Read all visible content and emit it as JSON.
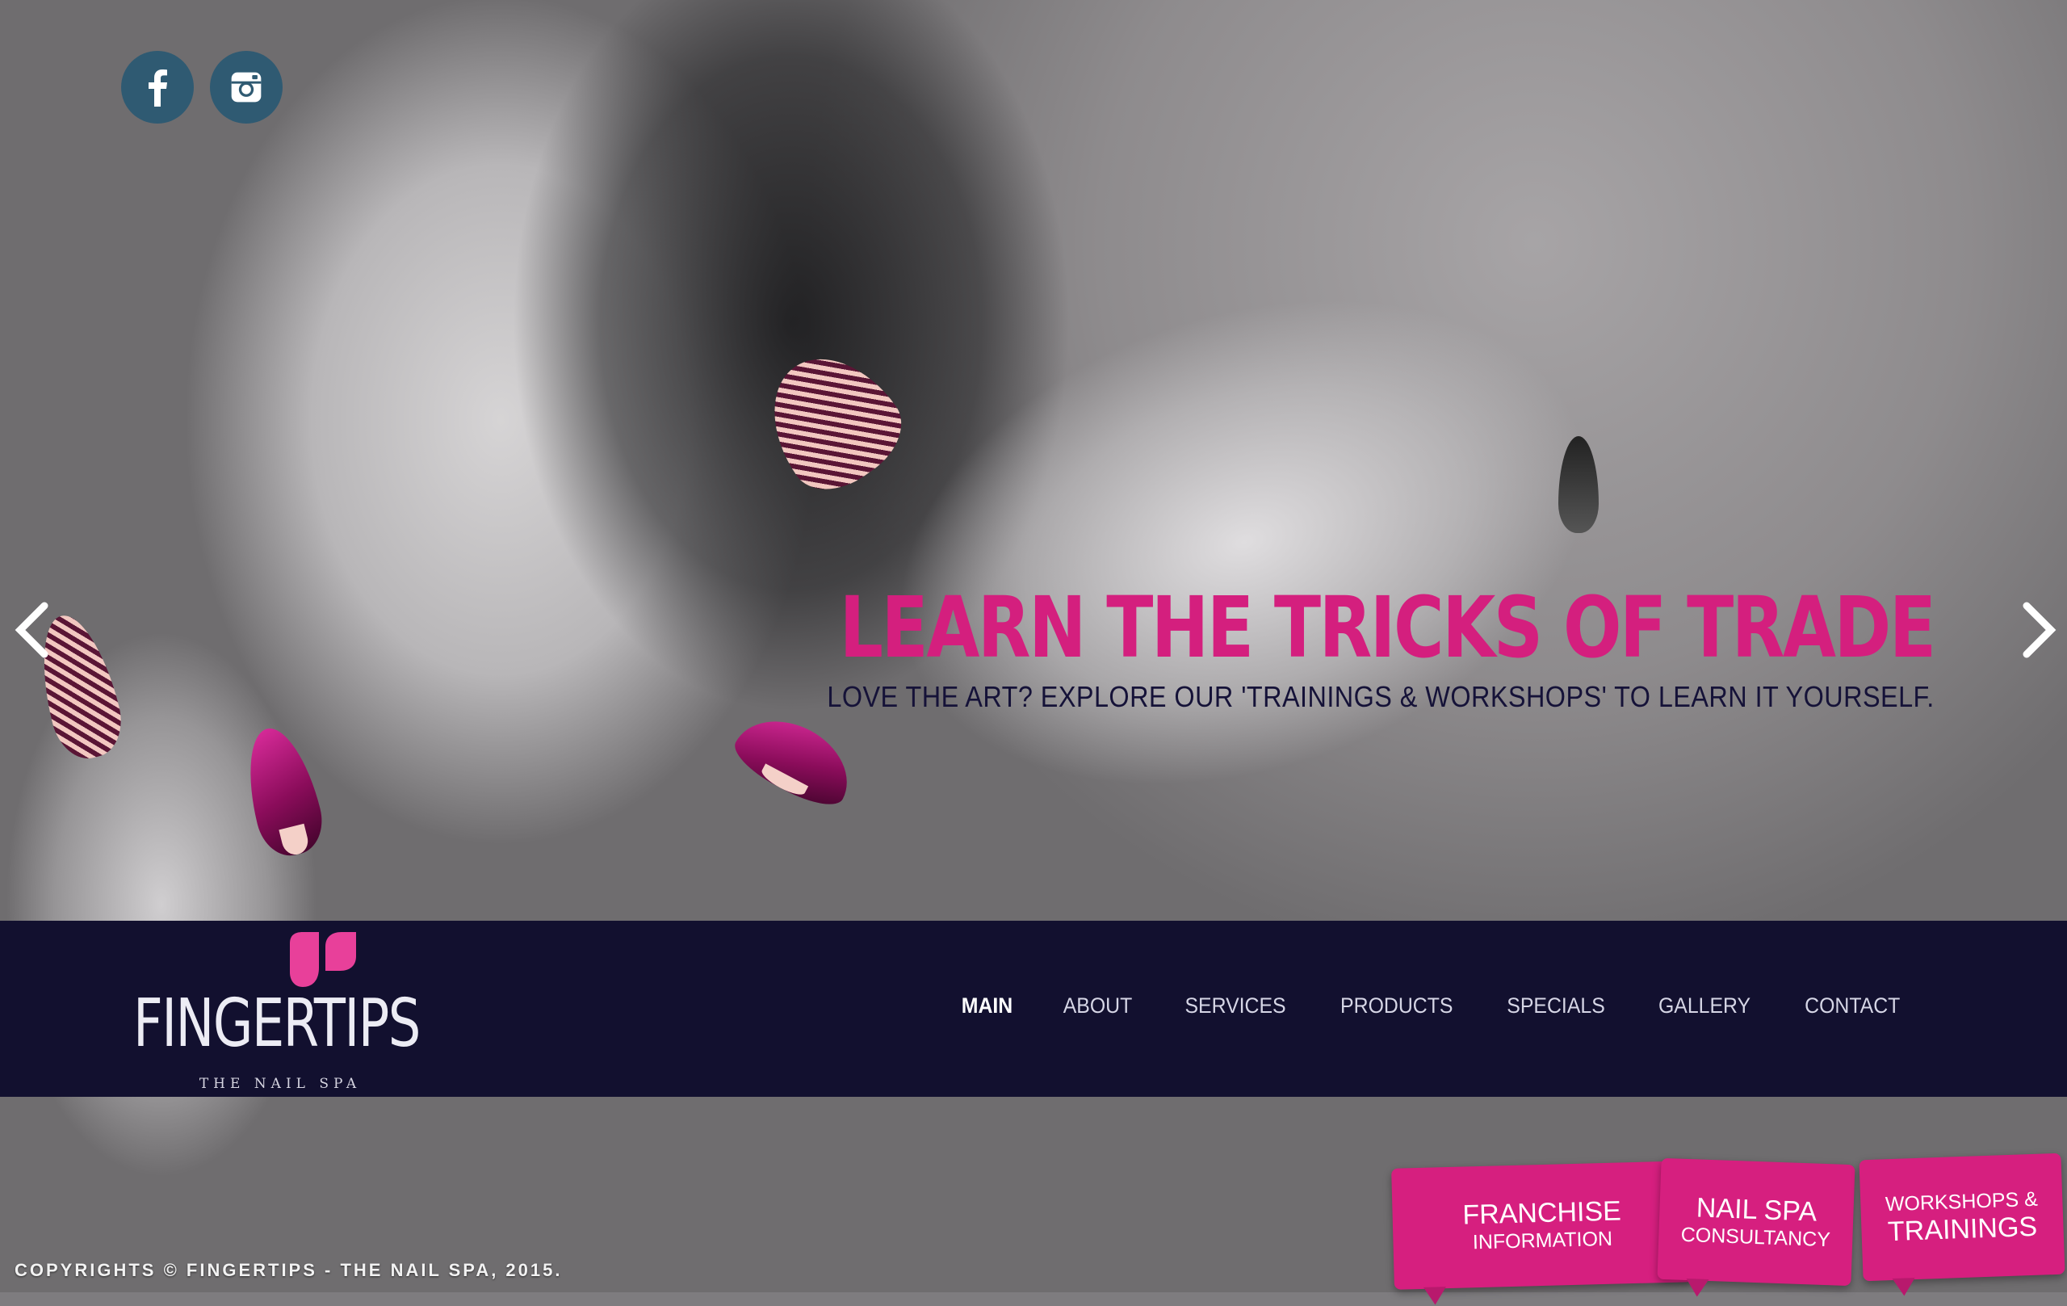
{
  "social": {
    "facebook_icon": "facebook-icon",
    "instagram_icon": "instagram-icon",
    "color": "#2f5a72"
  },
  "slider": {
    "headline": "LEARN THE TRICKS OF TRADE",
    "subtext": "LOVE THE ART? EXPLORE OUR 'TRAININGS & WORKSHOPS' TO LEARN IT YOURSELF.",
    "prev_icon": "chevron-left-icon",
    "next_icon": "chevron-right-icon",
    "headline_color": "#d41f7e"
  },
  "brand": {
    "name": "FINGERTIPS",
    "tagline": "THE NAIL SPA",
    "accent": "#e8409a"
  },
  "nav": {
    "items": [
      {
        "label": "MAIN",
        "active": true
      },
      {
        "label": "ABOUT"
      },
      {
        "label": "SERVICES"
      },
      {
        "label": "PRODUCTS"
      },
      {
        "label": "SPECIALS"
      },
      {
        "label": "GALLERY"
      },
      {
        "label": "CONTACT"
      }
    ],
    "background": "#12102f"
  },
  "tags": [
    {
      "line1": "FRANCHISE",
      "line2": "INFORMATION"
    },
    {
      "line1": "NAIL SPA",
      "line2": "CONSULTANCY"
    },
    {
      "line1": "WORKSHOPS &",
      "line2": "TRAININGS"
    }
  ],
  "footer": {
    "copyright": "COPYRIGHTS © FINGERTIPS - THE NAIL SPA, 2015."
  }
}
